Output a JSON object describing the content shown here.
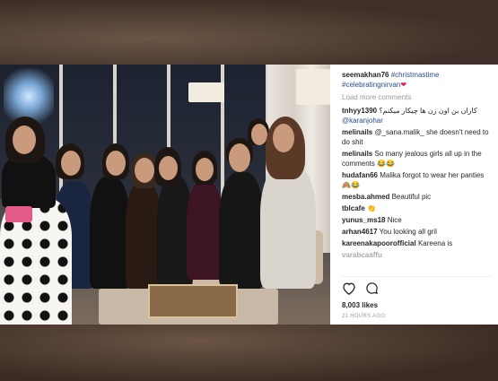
{
  "post": {
    "caption_user": "seemakhan76",
    "caption_tags": "#christmastime #celebratingnirvan",
    "caption_heart": "❤",
    "load_more": "Load more comments",
    "comments": [
      {
        "user": "tnhyy1390",
        "text": "کاراں بن اون زن ها چیکار میکنم؟",
        "mention": "@karanjohar",
        "emoji": ""
      },
      {
        "user": "melinails",
        "text": "@_sana.malik_ she doesn't need to do shit",
        "emoji": ""
      },
      {
        "user": "melinails",
        "text": "So many jealous girls all up in the comments",
        "emoji": "😂😂"
      },
      {
        "user": "hudafan66",
        "text": "Malika forgot to wear her panties",
        "emoji": "🙈😂"
      },
      {
        "user": "mesba.ahmed",
        "text": "Beautiful pic",
        "emoji": ""
      },
      {
        "user": "tblcafe",
        "text": "",
        "emoji": "👏"
      },
      {
        "user": "yunus_ms18",
        "text": "Nice",
        "emoji": ""
      },
      {
        "user": "arhan4617",
        "text": "You looking all gril",
        "emoji": ""
      },
      {
        "user": "kareenakapoorofficial",
        "text": "Kareena is",
        "emoji": ""
      },
      {
        "user": "varabcaaffu",
        "text": "",
        "emoji": "",
        "faded": true
      }
    ],
    "likes": "8,003 likes",
    "time": "21 HOURS AGO",
    "icons": {
      "like": "heart-outline-icon",
      "comment": "comment-bubble-icon"
    }
  }
}
